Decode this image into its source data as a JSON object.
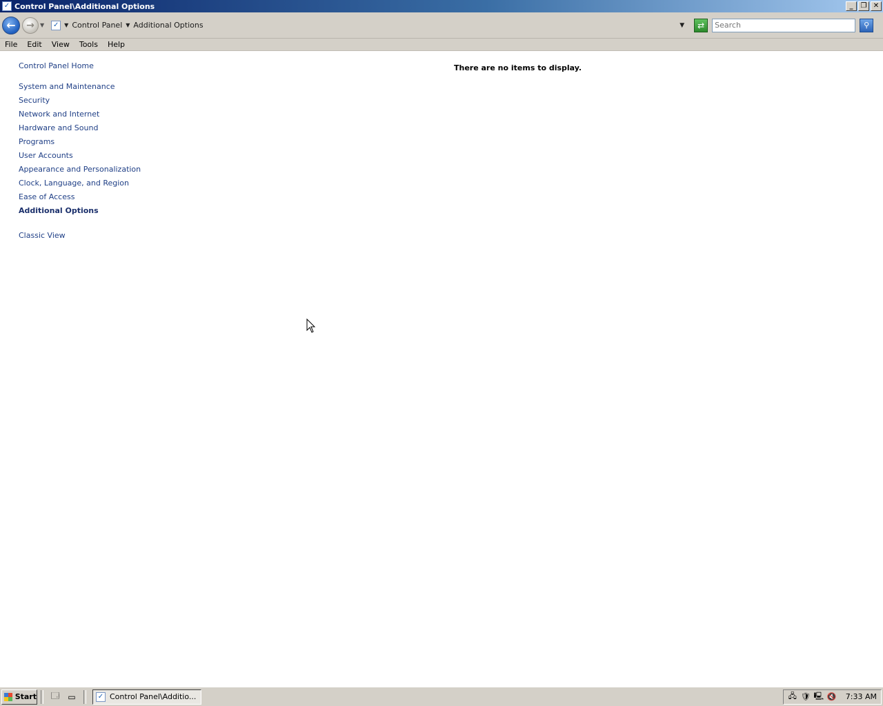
{
  "window": {
    "title": "Control Panel\\Additional Options",
    "buttons": {
      "minimize": "_",
      "restore": "❐",
      "close": "✕"
    }
  },
  "address": {
    "crumbs": [
      "Control Panel",
      "Additional Options"
    ],
    "search_placeholder": "Search"
  },
  "menu": [
    "File",
    "Edit",
    "View",
    "Tools",
    "Help"
  ],
  "sidebar": {
    "home": "Control Panel Home",
    "items": [
      "System and Maintenance",
      "Security",
      "Network and Internet",
      "Hardware and Sound",
      "Programs",
      "User Accounts",
      "Appearance and Personalization",
      "Clock, Language, and Region",
      "Ease of Access",
      "Additional Options"
    ],
    "current": "Additional Options",
    "classic_view": "Classic View"
  },
  "main": {
    "empty_message": "There are no items to display."
  },
  "taskbar": {
    "start_label": "Start",
    "task_button": "Control Panel\\Additio...",
    "clock": "7:33 AM"
  },
  "icons": {
    "back": "←",
    "forward": "→",
    "control_panel": "✓",
    "search": "⚲",
    "refresh": "⇄"
  }
}
